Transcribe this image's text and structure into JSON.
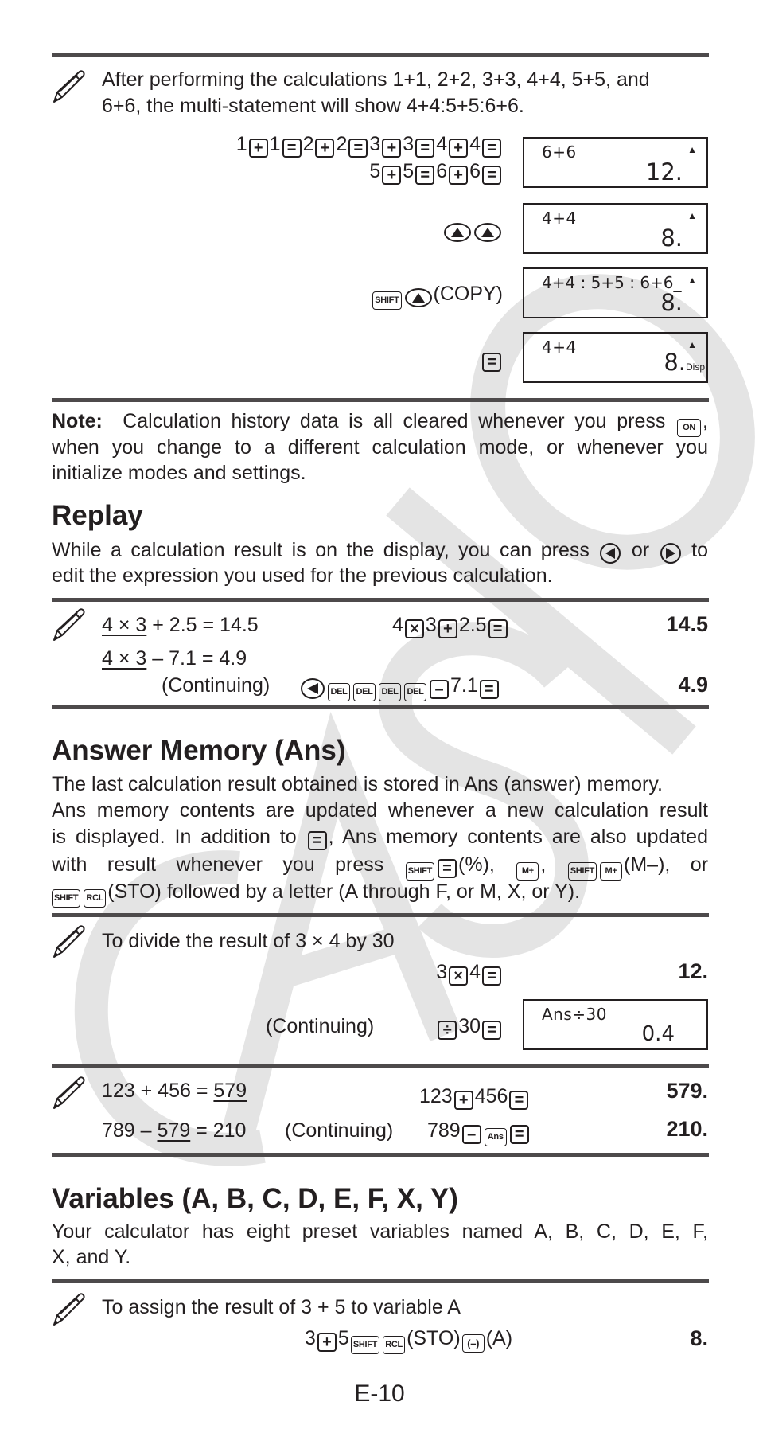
{
  "watermark": "CASIO",
  "colors": {
    "rule": "#4d4a4b",
    "text": "#231f20",
    "watermark": "#e3e3e3"
  },
  "multistatement_example": {
    "description_line1": "After performing the calculations 1+1, 2+2, 3+3, 4+4, 5+5, and",
    "description_line2": "6+6, the multi-statement will show 4+4:5+5:6+6.",
    "steps": [
      {
        "keys_row1": [
          "1",
          "+",
          "1",
          "=",
          "2",
          "+",
          "2",
          "=",
          "3",
          "+",
          "3",
          "=",
          "4",
          "+",
          "4",
          "="
        ],
        "keys_row2": [
          "5",
          "+",
          "5",
          "=",
          "6",
          "+",
          "6",
          "="
        ],
        "display": {
          "expr": "6+6",
          "value": "12.",
          "indicator": "▲"
        }
      },
      {
        "keys": [
          "▲",
          "▲"
        ],
        "display": {
          "expr": "4+4",
          "value": "8.",
          "indicator": "▲"
        }
      },
      {
        "keys": [
          "SHIFT",
          "▲"
        ],
        "suffix": "(COPY)",
        "display": {
          "expr": "4+4 : 5+5 : 6+6_",
          "value": "8.",
          "indicator": "▲"
        }
      },
      {
        "keys": [
          "="
        ],
        "display": {
          "expr": "4+4",
          "value": "8.",
          "indicator": "▲",
          "suffix": "Disp"
        }
      }
    ]
  },
  "note": {
    "label": "Note:",
    "line1": "Calculation history data is all cleared whenever you press",
    "key": "ON",
    "line1_end": ",",
    "line2": "when you change to a different calculation mode, or whenever you",
    "line3": "initialize modes and settings."
  },
  "replay": {
    "heading": "Replay",
    "body_line1_a": "While a calculation result is on the display, you can press",
    "body_line1_or": "or",
    "body_line1_to": "to",
    "body_line2": "edit the expression you used for the previous calculation.",
    "example": {
      "row1": {
        "underlined": "4 × 3",
        "rest": "+ 2.5 = 14.5",
        "keys": [
          "4",
          "×",
          "3",
          "+",
          "2.5",
          "="
        ],
        "result": "14.5"
      },
      "row2": {
        "underlined": "4 × 3",
        "rest": "– 7.1 = 4.9"
      },
      "row3": {
        "label": "(Continuing)",
        "keys": [
          "◀",
          "DEL",
          "DEL",
          "DEL",
          "DEL",
          "–",
          "7.1",
          "="
        ],
        "result": "4.9"
      }
    }
  },
  "answer_memory": {
    "heading": "Answer Memory (Ans)",
    "line1": "The last calculation result obtained is stored in Ans (answer) memory.",
    "line2": "Ans memory contents are updated whenever a new calculation result",
    "line3_a": "is displayed. In addition to",
    "line3_b": ", Ans memory contents are also updated",
    "line4_a": "with result whenever you press",
    "line4_pct": "(%),",
    "line4_comma": ",",
    "line4_mminus": "(M–), or",
    "line5_sto": "(STO) followed by a letter (A through F, or M, X, or Y).",
    "key_shift": "SHIFT",
    "key_mplus": "M+",
    "key_rcl": "RCL",
    "example1": {
      "description": "To divide the result of 3 × 4 by 30",
      "row1": {
        "keys": [
          "3",
          "×",
          "4",
          "="
        ],
        "result": "12."
      },
      "row2": {
        "label": "(Continuing)",
        "keys": [
          "÷",
          "30",
          "="
        ],
        "display": {
          "expr": "Ans÷30",
          "value": "0.4"
        }
      }
    },
    "example2": {
      "row1": {
        "expr_a": "123 + 456 = ",
        "expr_u": "579",
        "keys": [
          "123",
          "+",
          "456",
          "="
        ],
        "result": "579."
      },
      "row2": {
        "expr_a": "789 – ",
        "expr_u": "579",
        "expr_b": " = 210",
        "label": "(Continuing)",
        "keys": [
          "789",
          "–",
          "Ans",
          "="
        ],
        "result": "210."
      }
    }
  },
  "variables": {
    "heading": "Variables (A, B, C, D, E, F, X, Y)",
    "line1": "Your calculator has eight preset variables named A, B, C, D, E, F,",
    "line2": "X, and Y.",
    "example": {
      "description": "To assign the result of 3 + 5 to variable A",
      "num1": "3",
      "num2": "5",
      "key_shift": "SHIFT",
      "key_rcl": "RCL",
      "sto": "(STO)",
      "key_neg": "(–)",
      "var": "(A)",
      "result": "8."
    }
  },
  "page_number": "E-10"
}
